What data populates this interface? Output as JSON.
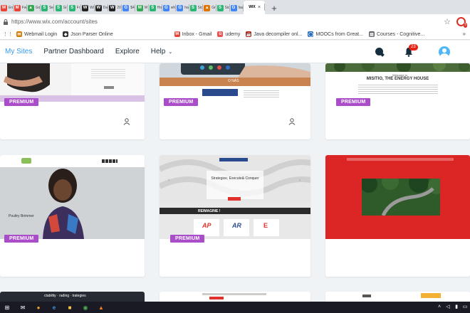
{
  "browser": {
    "tabs": [
      {
        "icon": "M",
        "color": "#ea4335",
        "title": "En"
      },
      {
        "icon": "M",
        "color": "#ea4335",
        "title": "Fw"
      },
      {
        "icon": "▲",
        "color": "#34a853",
        "title": "Go"
      },
      {
        "icon": "S",
        "color": "#2bb673",
        "title": "Se"
      },
      {
        "icon": "S",
        "color": "#2bb673",
        "title": "Gi"
      },
      {
        "icon": "S",
        "color": "#2bb673",
        "title": "Fr"
      },
      {
        "icon": "W",
        "color": "#222222",
        "title": "Wi"
      },
      {
        "icon": "W",
        "color": "#222222",
        "title": "Da"
      },
      {
        "icon": "W",
        "color": "#222222",
        "title": "20"
      },
      {
        "icon": "G",
        "color": "#4285f4",
        "title": "$4"
      },
      {
        "icon": "M",
        "color": "#34a853",
        "title": "M"
      },
      {
        "icon": "S",
        "color": "#2bb673",
        "title": "Ho"
      },
      {
        "icon": "G",
        "color": "#4285f4",
        "title": "wh"
      },
      {
        "icon": "G",
        "color": "#4285f4",
        "title": "ha"
      },
      {
        "icon": "S",
        "color": "#2bb673",
        "title": "Sic"
      },
      {
        "icon": "▲",
        "color": "#e37400",
        "title": "Gr"
      },
      {
        "icon": "S",
        "color": "#2bb673",
        "title": "Sic"
      },
      {
        "icon": "G",
        "color": "#4285f4",
        "title": "fau"
      }
    ],
    "active_tab": {
      "icon": "WIX",
      "title": "",
      "close": "×"
    },
    "new_tab": "+",
    "url": "https://www.wix.com/account/sites",
    "star": "☆",
    "ext_count": "5",
    "bookmarks": [
      {
        "icon": "✉",
        "color": "#d07a00",
        "label": "Webmail Login"
      },
      {
        "icon": "◆",
        "color": "#333333",
        "label": "Json Parser Online"
      },
      {
        "icon": "M",
        "color": "#ea4335",
        "label": "Inbox - Gmail"
      },
      {
        "icon": "ü",
        "color": "#ec5252",
        "label": "udemy"
      },
      {
        "icon": "☕",
        "color": "#b3261e",
        "label": "Java decompiler onl..."
      },
      {
        "icon": "◯",
        "color": "#2a6ebb",
        "label": "MOOCs from Great..."
      },
      {
        "icon": "▤",
        "color": "#5f6368",
        "label": "Courses - Cognitive..."
      }
    ],
    "bookmarks_more": "»"
  },
  "wix": {
    "nav": {
      "my_sites": "My Sites",
      "partner_dashboard": "Partner Dashboard",
      "explore": "Explore",
      "help": "Help",
      "help_chevron": "⌄"
    },
    "notifications": "23",
    "cards": [
      {
        "badge": "PREMIUM"
      },
      {
        "badge": "PREMIUM",
        "mini_title": "O NÁS"
      },
      {
        "badge": "PREMIUM",
        "mini_title": "MISITIO, THE ENERGY HOUSE",
        "welcome": "Welcome to"
      },
      {
        "badge": "PREMIUM",
        "caption": "Poultry Brimmer"
      },
      {
        "badge": "PREMIUM",
        "headline": "Strategize, Execute& Conquer",
        "section": "REIMAGINE !"
      },
      {
        "badge": ""
      }
    ],
    "bottom_cards": [
      {
        "text": "ctability · rading · trategies"
      },
      {
        "text": ""
      },
      {
        "text": ""
      }
    ]
  },
  "colors": {
    "premium": "#aa4dc8",
    "accent": "#3899ec",
    "notif": "#e62214"
  }
}
